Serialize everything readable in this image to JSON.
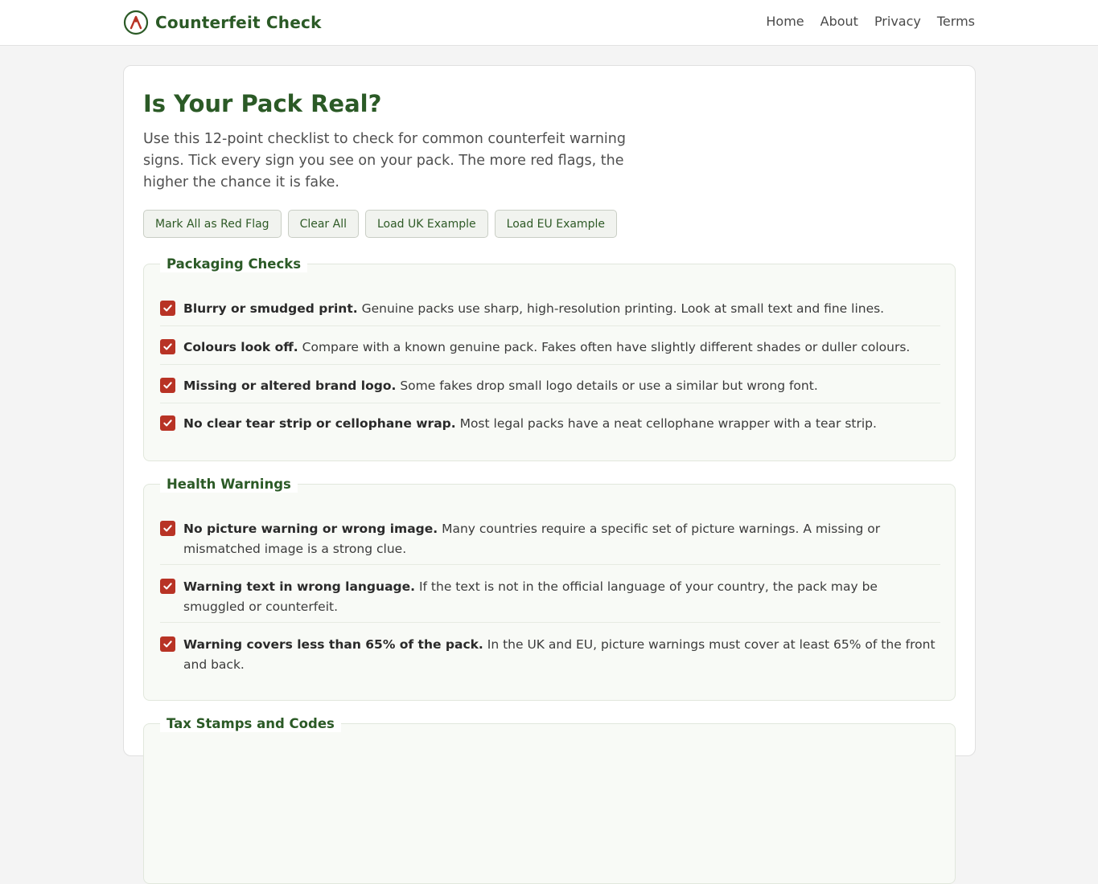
{
  "header": {
    "brand": "Counterfeit Check",
    "nav": [
      "Home",
      "About",
      "Privacy",
      "Terms"
    ]
  },
  "main": {
    "title": "Is Your Pack Real?",
    "intro": "Use this 12-point checklist to check for common counterfeit warning signs. Tick every sign you see on your pack. The more red flags, the higher the chance it is fake.",
    "buttons": [
      "Mark All as Red Flag",
      "Clear All",
      "Load UK Example",
      "Load EU Example"
    ]
  },
  "sections": [
    {
      "title": "Packaging Checks",
      "items": [
        {
          "title": "Blurry or smudged print.",
          "desc": "Genuine packs use sharp, high-resolution printing. Look at small text and fine lines.",
          "checked": true
        },
        {
          "title": "Colours look off.",
          "desc": "Compare with a known genuine pack. Fakes often have slightly different shades or duller colours.",
          "checked": true
        },
        {
          "title": "Missing or altered brand logo.",
          "desc": "Some fakes drop small logo details or use a similar but wrong font.",
          "checked": true
        },
        {
          "title": "No clear tear strip or cellophane wrap.",
          "desc": "Most legal packs have a neat cellophane wrapper with a tear strip.",
          "checked": true
        }
      ]
    },
    {
      "title": "Health Warnings",
      "items": [
        {
          "title": "No picture warning or wrong image.",
          "desc": "Many countries require a specific set of picture warnings. A missing or mismatched image is a strong clue.",
          "checked": true
        },
        {
          "title": "Warning text in wrong language.",
          "desc": "If the text is not in the official language of your country, the pack may be smuggled or counterfeit.",
          "checked": true
        },
        {
          "title": "Warning covers less than 65% of the pack.",
          "desc": "In the UK and EU, picture warnings must cover at least 65% of the front and back.",
          "checked": true
        }
      ]
    },
    {
      "title": "Tax Stamps and Codes",
      "items": []
    }
  ],
  "colors": {
    "brand": "#2b5a26",
    "check": "#b83325"
  }
}
